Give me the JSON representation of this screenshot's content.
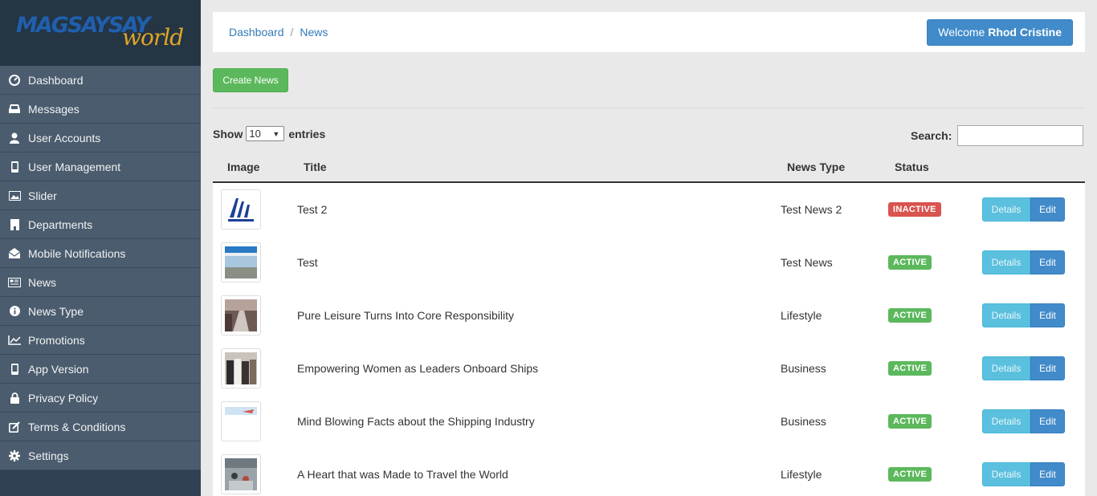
{
  "logo": {
    "part1": "MAGSAYSAY",
    "part2": "world"
  },
  "sidebar": {
    "items": [
      {
        "label": "Dashboard",
        "icon": "dashboard-icon"
      },
      {
        "label": "Messages",
        "icon": "inbox-icon"
      },
      {
        "label": "User Accounts",
        "icon": "user-icon"
      },
      {
        "label": "User Management",
        "icon": "mobile-icon"
      },
      {
        "label": "Slider",
        "icon": "image-icon"
      },
      {
        "label": "Departments",
        "icon": "building-icon"
      },
      {
        "label": "Mobile Notifications",
        "icon": "envelope-open-icon"
      },
      {
        "label": "News",
        "icon": "newspaper-icon"
      },
      {
        "label": "News Type",
        "icon": "info-circle-icon"
      },
      {
        "label": "Promotions",
        "icon": "line-chart-icon"
      },
      {
        "label": "App Version",
        "icon": "mobile-icon"
      },
      {
        "label": "Privacy Policy",
        "icon": "lock-icon"
      },
      {
        "label": "Terms & Conditions",
        "icon": "edit-icon"
      },
      {
        "label": "Settings",
        "icon": "gear-icon"
      }
    ]
  },
  "header": {
    "breadcrumb": [
      "Dashboard",
      "News"
    ],
    "welcome_prefix": "Welcome",
    "welcome_user": "Rhod Cristine"
  },
  "toolbar": {
    "create_label": "Create News"
  },
  "table_controls": {
    "show_label": "Show",
    "entries_value": "10",
    "entries_label": "entries",
    "search_label": "Search:",
    "search_value": ""
  },
  "table": {
    "columns": [
      "Image",
      "Title",
      "News Type",
      "Status"
    ],
    "rows": [
      {
        "title": "Test 2",
        "type": "Test News 2",
        "status": "INACTIVE"
      },
      {
        "title": "Test",
        "type": "Test News",
        "status": "ACTIVE"
      },
      {
        "title": "Pure Leisure Turns Into Core Responsibility",
        "type": "Lifestyle",
        "status": "ACTIVE"
      },
      {
        "title": "Empowering Women as Leaders Onboard Ships",
        "type": "Business",
        "status": "ACTIVE"
      },
      {
        "title": "Mind Blowing Facts about the Shipping Industry",
        "type": "Business",
        "status": "ACTIVE"
      },
      {
        "title": "A Heart that was Made to Travel the World",
        "type": "Lifestyle",
        "status": "ACTIVE"
      }
    ],
    "details_label": "Details",
    "edit_label": "Edit"
  },
  "colors": {
    "sidebar_bg": "#4a5c6e",
    "logo_bg": "#253544",
    "active_badge": "#5cb85c",
    "inactive_badge": "#d9534f",
    "primary": "#428bca",
    "info": "#5bc0de"
  }
}
